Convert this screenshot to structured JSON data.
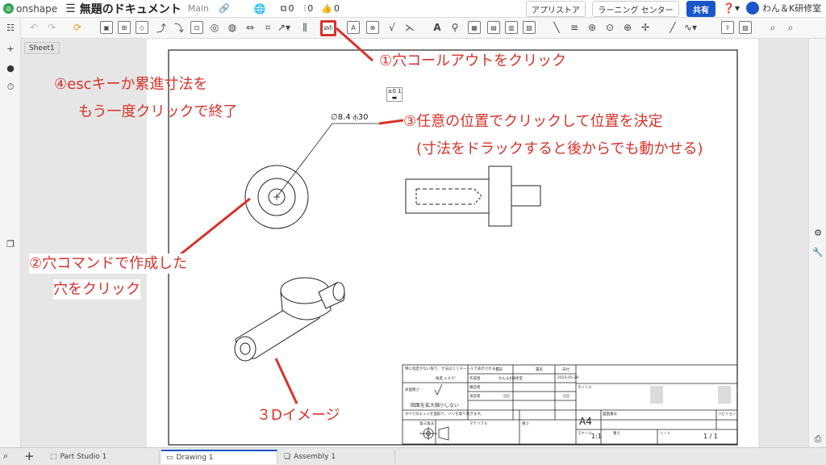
{
  "topbar": {
    "logo_text": "onshape",
    "doc_title": "無題のドキュメント",
    "branch": "Main",
    "counts": {
      "copies": "0",
      "branches": "0",
      "likes": "0"
    },
    "appstore_label": "アプリストア",
    "learning_label": "ラーニング センター",
    "share_label": "共有",
    "user_name": "わん＆K研修室"
  },
  "sheet_tab": "Sheet1",
  "drawing": {
    "hole_dimension": "∅8.4 ⫛30",
    "tolerance_label": "±0.1"
  },
  "title_block": {
    "paper_size": "A4",
    "scale": "1:1",
    "sheet_number": "1 / 1",
    "no_scale_note": "図面を拡大縮小しない",
    "labels": {
      "general_tol": "特に指定がない限り、寸法はミリメートルで表示されます。",
      "angle": "角度 ± 0.5°",
      "surface": "表面粗さ",
      "edges": "すべてのエッジを面取り、バリを取り除きます。",
      "projection": "第三角法",
      "material": "マテリアル",
      "weight": "重さ",
      "name": "名前",
      "signature": "署名",
      "date": "日付",
      "created_by": "作成者",
      "checked_by": "確認者",
      "approved_by": "承認者",
      "author_value": "わん＆K研修室",
      "date_value": "2023-05-29",
      "title": "タイトル",
      "drawing_number": "図面番号",
      "revision": "リビジョン",
      "scale_label": "スケール",
      "weight2": "重さ",
      "sheet_label": "シート"
    }
  },
  "annotations": {
    "step1": "①穴コールアウトをクリック",
    "step2_line1": "②穴コマンドで作成した",
    "step2_line2": "穴をクリック",
    "step3_line1": "③任意の位置でクリックして位置を決定",
    "step3_line2": "(寸法をドラックすると後からでも動かせる)",
    "step4_line1": "④escキーか累進寸法を",
    "step4_line2": "もう一度クリックで終了",
    "step5": "３Dイメージ"
  },
  "bottom_tabs": [
    {
      "label": "Part Studio 1"
    },
    {
      "label": "Drawing 1"
    },
    {
      "label": "Assembly 1"
    }
  ],
  "colors": {
    "annotation": "#d9322a",
    "share_button": "#1a56c9",
    "logo": "#2da44e"
  }
}
